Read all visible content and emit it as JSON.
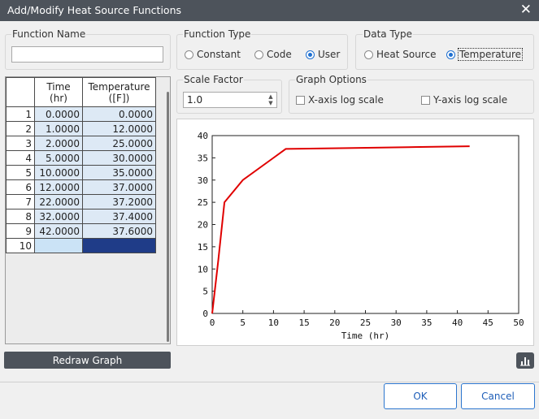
{
  "window": {
    "title": "Add/Modify Heat Source Functions"
  },
  "function_name": {
    "label": "Function Name",
    "value": ""
  },
  "function_type": {
    "label": "Function Type",
    "options": [
      "Constant",
      "Code",
      "User"
    ],
    "selected": "User"
  },
  "data_type": {
    "label": "Data Type",
    "options": [
      "Heat Source",
      "Temperature"
    ],
    "selected": "Temperature"
  },
  "scale_factor": {
    "label": "Scale Factor",
    "value": "1.0"
  },
  "graph_options": {
    "label": "Graph Options",
    "x_log": "X-axis log scale",
    "y_log": "Y-axis log scale",
    "x_log_checked": false,
    "y_log_checked": false
  },
  "table": {
    "headers": [
      "Time\n(hr)",
      "Temperature\n([F])"
    ],
    "rows": [
      {
        "n": "1",
        "time": "0.0000",
        "temp": "0.0000"
      },
      {
        "n": "2",
        "time": "1.0000",
        "temp": "12.0000"
      },
      {
        "n": "3",
        "time": "2.0000",
        "temp": "25.0000"
      },
      {
        "n": "4",
        "time": "5.0000",
        "temp": "30.0000"
      },
      {
        "n": "5",
        "time": "10.0000",
        "temp": "35.0000"
      },
      {
        "n": "6",
        "time": "12.0000",
        "temp": "37.0000"
      },
      {
        "n": "7",
        "time": "22.0000",
        "temp": "37.2000"
      },
      {
        "n": "8",
        "time": "32.0000",
        "temp": "37.4000"
      },
      {
        "n": "9",
        "time": "42.0000",
        "temp": "37.6000"
      }
    ],
    "new_row": "10"
  },
  "buttons": {
    "redraw": "Redraw Graph",
    "ok": "OK",
    "cancel": "Cancel"
  },
  "icons": {
    "close": "close-icon",
    "graph": "bar-chart-icon"
  },
  "chart_data": {
    "type": "line",
    "xlabel": "Time (hr)",
    "ylabel": "",
    "xlim": [
      0,
      50
    ],
    "ylim": [
      0,
      40
    ],
    "xticks": [
      0,
      5,
      10,
      15,
      20,
      25,
      30,
      35,
      40,
      45,
      50
    ],
    "yticks": [
      0,
      5,
      10,
      15,
      20,
      25,
      30,
      35,
      40
    ],
    "grid": false,
    "line_color": "#e00000",
    "x": [
      0,
      1,
      2,
      5,
      10,
      12,
      22,
      32,
      42
    ],
    "y": [
      0,
      12,
      25,
      30,
      35,
      37,
      37.2,
      37.4,
      37.6
    ]
  }
}
